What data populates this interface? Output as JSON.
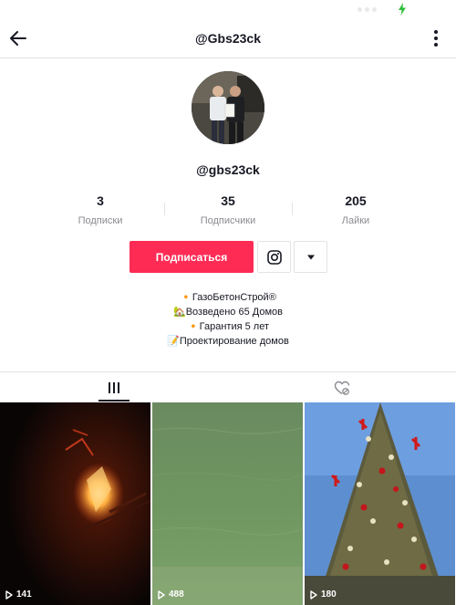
{
  "status_bar": {
    "battery_color": "#2fbd3b"
  },
  "header": {
    "title": "@Gbs23ck",
    "back_icon": "arrow-left-icon",
    "more_icon": "more-vertical-icon"
  },
  "profile": {
    "username": "@gbs23ck",
    "avatar": "avatar-photo"
  },
  "stats": [
    {
      "value": "3",
      "label": "Подписки"
    },
    {
      "value": "35",
      "label": "Подписчики"
    },
    {
      "value": "205",
      "label": "Лайки"
    }
  ],
  "actions": {
    "follow_label": "Подписаться",
    "follow_color": "#fe2c55",
    "instagram_icon": "instagram-icon",
    "dropdown_icon": "caret-down-icon"
  },
  "bio": [
    "🔸ГазоБетонСтрой®",
    "🏡Возведено 65 Домов",
    "🔸Гарантия 5 лет",
    "📝Проектирование домов"
  ],
  "tabs": [
    {
      "icon": "videos-grid-icon",
      "active": true
    },
    {
      "icon": "liked-heart-icon",
      "active": false
    }
  ],
  "videos": [
    {
      "views": "141",
      "thumb": "fire-at-night"
    },
    {
      "views": "488",
      "thumb": "green-water"
    },
    {
      "views": "180",
      "thumb": "christmas-tree"
    }
  ]
}
